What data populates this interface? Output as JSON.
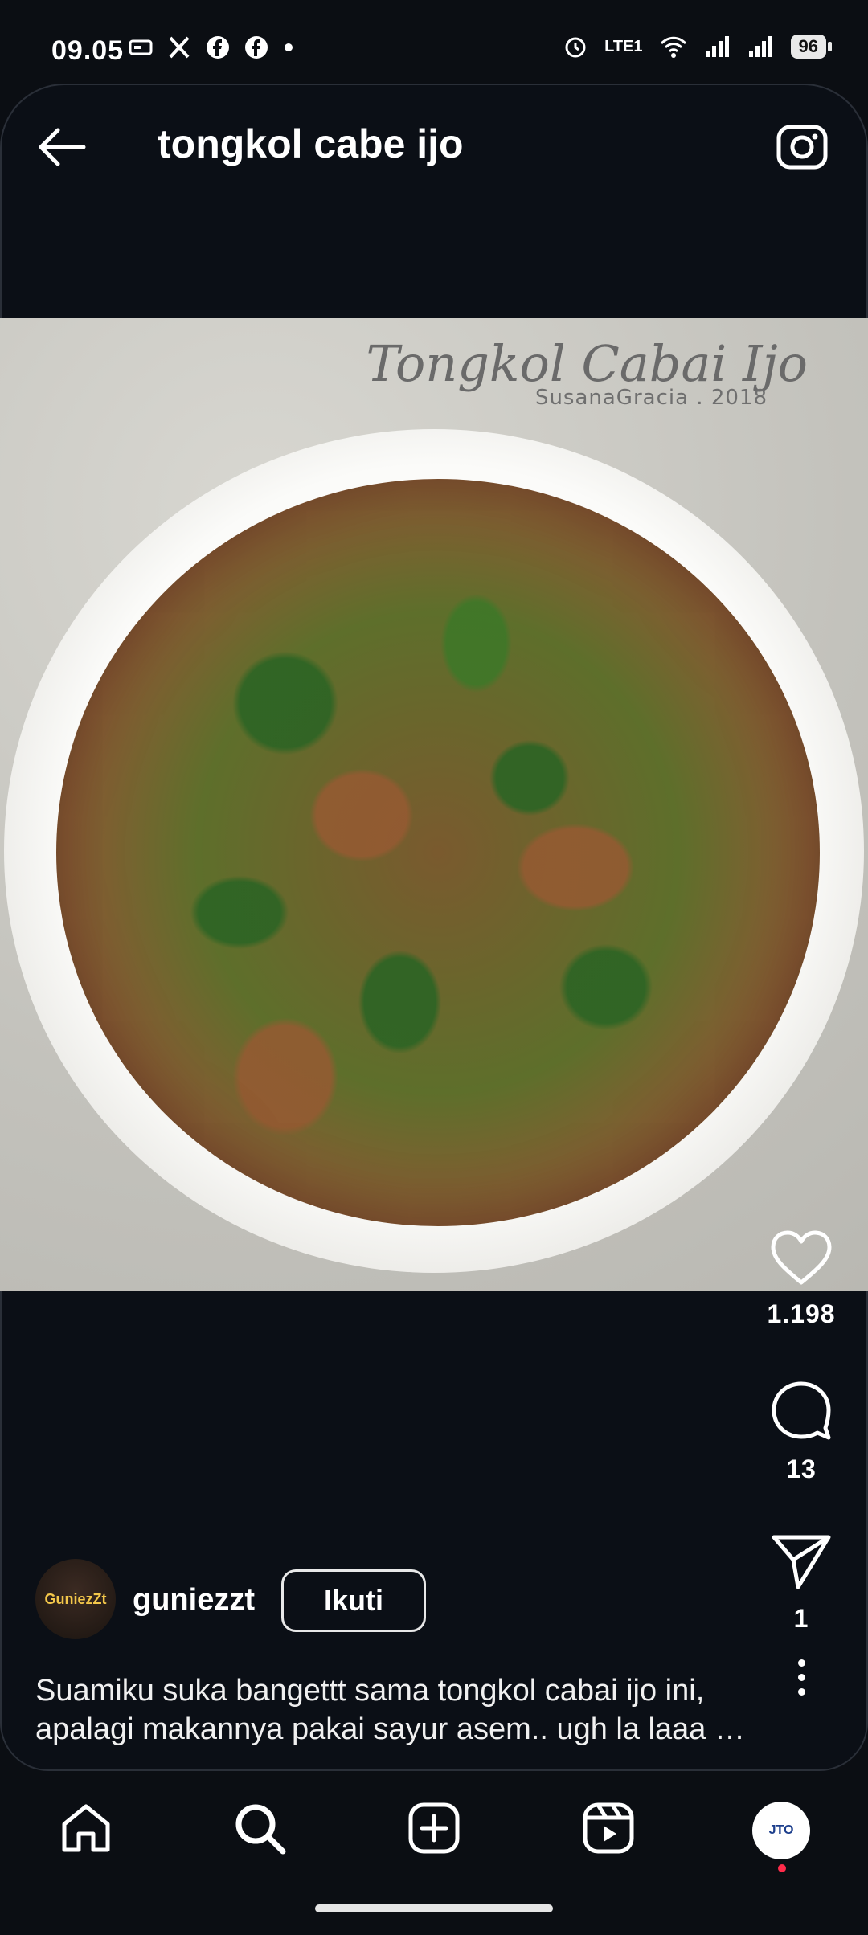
{
  "status_bar": {
    "time": "09.05",
    "battery": "96",
    "network": "LTE1"
  },
  "header": {
    "title": "tongkol cabe ijo"
  },
  "post": {
    "watermark_title": "Tongkol Cabai Ijo",
    "watermark_credit": "SusanaGracia . 2018",
    "likes": "1.198",
    "comments": "13",
    "shares": "1",
    "author": {
      "username": "guniezzt",
      "avatar_text": "GuniezZt"
    },
    "follow_label": "Ikuti",
    "caption_line1": "Suamiku suka bangettt sama tongkol cabai ijo ini,",
    "caption_line2": "apalagi makannya pakai sayur asem.. ugh la laaa …"
  },
  "bottom_nav": {
    "profile_text": "JTO"
  },
  "colors": {
    "background": "#0b0e13",
    "notification_dot": "#ff2b4a"
  },
  "icons": {
    "back": "arrow-left-icon",
    "camera": "camera-icon",
    "like": "heart-icon",
    "comment": "comment-icon",
    "share": "send-icon",
    "more": "more-vertical-icon",
    "home": "home-icon",
    "search": "search-icon",
    "create": "plus-square-icon",
    "reels": "reels-icon"
  }
}
